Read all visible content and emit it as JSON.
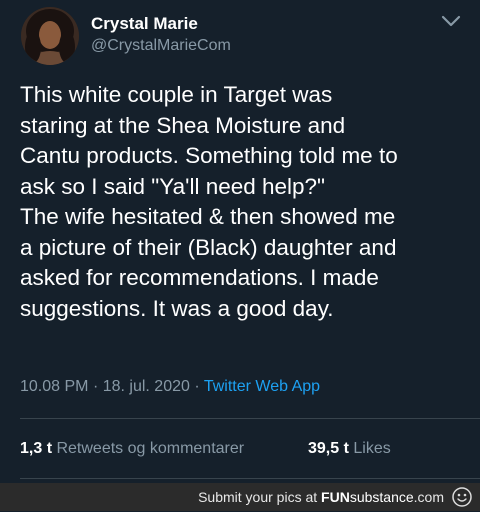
{
  "tweet": {
    "author_name": "Crystal Marie",
    "author_handle": "@CrystalMarieCom",
    "text": "This white couple in Target was\nstaring at the Shea Moisture and\nCantu products. Something told me to\nask so I said \"Ya'll need help?\"\nThe wife hesitated & then showed me\na picture of their (Black) daughter and\nasked for recommendations. I made\nsuggestions. It was a good day.",
    "time": "10.08 PM",
    "separator": "·",
    "date": "18. jul. 2020",
    "source": "Twitter Web App",
    "retweets_count": "1,3 t",
    "retweets_label": "Retweets og kommentarer",
    "likes_count": "39,5 t",
    "likes_label": "Likes"
  },
  "footer": {
    "caption": "Submit your pics at",
    "brand_part1": "FUN",
    "brand_part2": "substance",
    "brand_tld": ".com"
  },
  "icons": {
    "menu": "chevron-down-icon",
    "watermark": "funsubstance-logo-icon"
  },
  "colors": {
    "background": "#15202b",
    "secondary_text": "#8899a6",
    "link": "#1da1f2",
    "divider": "#38444d",
    "footer_bg": "#2b2b2b"
  }
}
